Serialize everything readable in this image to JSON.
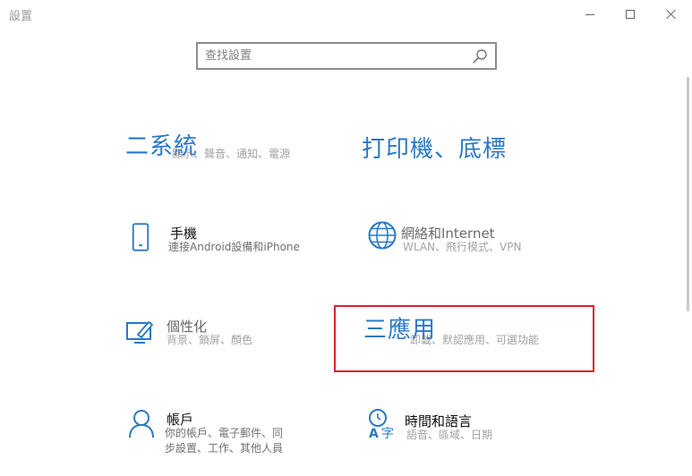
{
  "window": {
    "title": "設置",
    "controls": {
      "minimize": "minimize",
      "maximize": "maximize",
      "close": "close"
    }
  },
  "search": {
    "placeholder": "查找設置",
    "value": ""
  },
  "tiles": [
    {
      "id": "system",
      "title": "二系統",
      "desc": "顯示、聲音、通知、電源",
      "icon": "system-icon"
    },
    {
      "id": "devices",
      "title": "打印機、底標",
      "desc": "",
      "icon": "devices-icon"
    },
    {
      "id": "phone",
      "title": "手機",
      "desc": "連接Android設備和iPhone",
      "icon": "phone-icon"
    },
    {
      "id": "network",
      "title": "網絡和Internet",
      "desc": "WLAN、飛行模式、VPN",
      "icon": "globe-icon"
    },
    {
      "id": "personalization",
      "title": "個性化",
      "desc": "背景、鎖屏、顏色",
      "icon": "personalization-icon"
    },
    {
      "id": "apps",
      "title": "三應用",
      "desc": "卸載、默認應用、可選功能",
      "icon": "apps-icon"
    },
    {
      "id": "accounts",
      "title": "帳戶",
      "desc_lines": [
        "你的帳戶、電子郵件、同",
        "步設置、工作、其他人員"
      ],
      "icon": "person-icon"
    },
    {
      "id": "time-language",
      "title": "時間和語言",
      "desc": "語音、區域、日期",
      "icon": "time-language-icon"
    }
  ],
  "colors": {
    "accent": "#2a78c8",
    "highlight_border": "#d9232e"
  }
}
